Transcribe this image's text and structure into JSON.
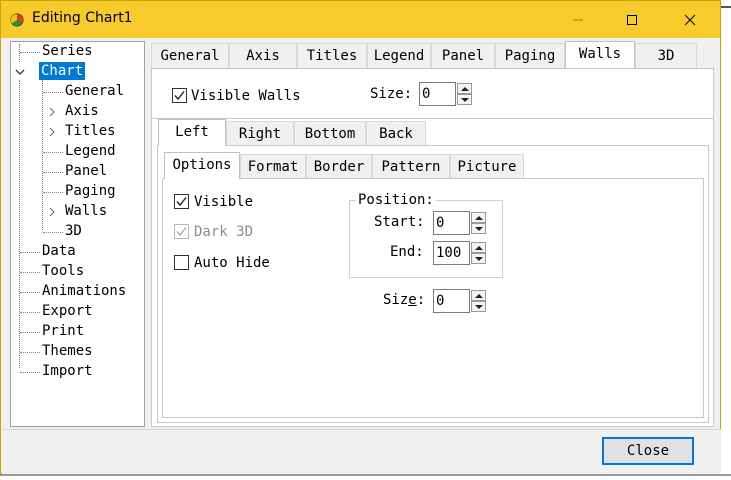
{
  "window": {
    "title": "Editing Chart1"
  },
  "tree": {
    "items": [
      {
        "label": "Series"
      },
      {
        "label": "Chart"
      },
      {
        "label": "General"
      },
      {
        "label": "Axis"
      },
      {
        "label": "Titles"
      },
      {
        "label": "Legend"
      },
      {
        "label": "Panel"
      },
      {
        "label": "Paging"
      },
      {
        "label": "Walls"
      },
      {
        "label": "3D"
      },
      {
        "label": "Data"
      },
      {
        "label": "Tools"
      },
      {
        "label": "Animations"
      },
      {
        "label": "Export"
      },
      {
        "label": "Print"
      },
      {
        "label": "Themes"
      },
      {
        "label": "Import"
      }
    ]
  },
  "main_tabs": [
    "General",
    "Axis",
    "Titles",
    "Legend",
    "Panel",
    "Paging",
    "Walls",
    "3D"
  ],
  "walls": {
    "visible_walls_label": "Visible Walls",
    "visible_walls_checked": true,
    "size_label": "Size:",
    "size_value": "0"
  },
  "wall_tabs": [
    "Left",
    "Right",
    "Bottom",
    "Back"
  ],
  "sub_tabs": [
    "Options",
    "Format",
    "Border",
    "Pattern",
    "Picture"
  ],
  "options": {
    "visible_label": "Visible",
    "visible_checked": true,
    "dark3d_label": "Dark 3D",
    "dark3d_checked": true,
    "autohide_label": "Auto Hide",
    "autohide_checked": false,
    "position_title": "Position:",
    "start_label": "Start:",
    "start_value": "0",
    "end_label": "End:",
    "end_value": "100",
    "size_label_pre": "Siz",
    "size_label_accel": "e",
    "size_label_post": ":",
    "size_value": "0"
  },
  "buttons": {
    "close_label": "Close"
  },
  "colors": {
    "titlebar": "#f8cb2c",
    "selection": "#0078d7",
    "focus_border": "#0078d7"
  }
}
